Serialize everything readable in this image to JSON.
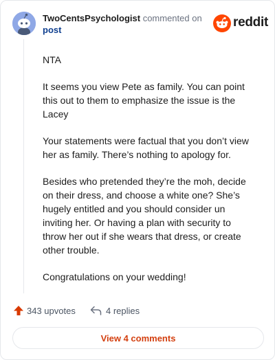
{
  "header": {
    "username": "TwoCentsPsychologist",
    "action": "commented on",
    "link": "post",
    "logo_text": "reddit",
    "avatar_icon": "snoo-avatar-icon",
    "logo_icon": "reddit-snoo-logo-icon"
  },
  "comment": {
    "paragraphs": [
      "NTA",
      "It seems you view Pete as family. You can point this out to them to emphasize the issue is the Lacey",
      "Your statements were factual that you don’t view her as family. There’s nothing to apology for.",
      "Besides who pretended they’re the moh, decide on their dress, and choose a white one? She’s hugely entitled and you should consider un inviting her. Or having a plan with security to throw her out if she wears that dress, or create other trouble.",
      "Congratulations on your wedding!"
    ]
  },
  "footer": {
    "upvotes": "343 upvotes",
    "replies": "4 replies",
    "upvote_icon": "upvote-arrow-icon",
    "reply_icon": "reply-arrow-icon",
    "view_comments": "View 4 comments"
  },
  "colors": {
    "accent": "#d93a00",
    "link": "#0f3f8f",
    "muted": "#6b7280"
  }
}
